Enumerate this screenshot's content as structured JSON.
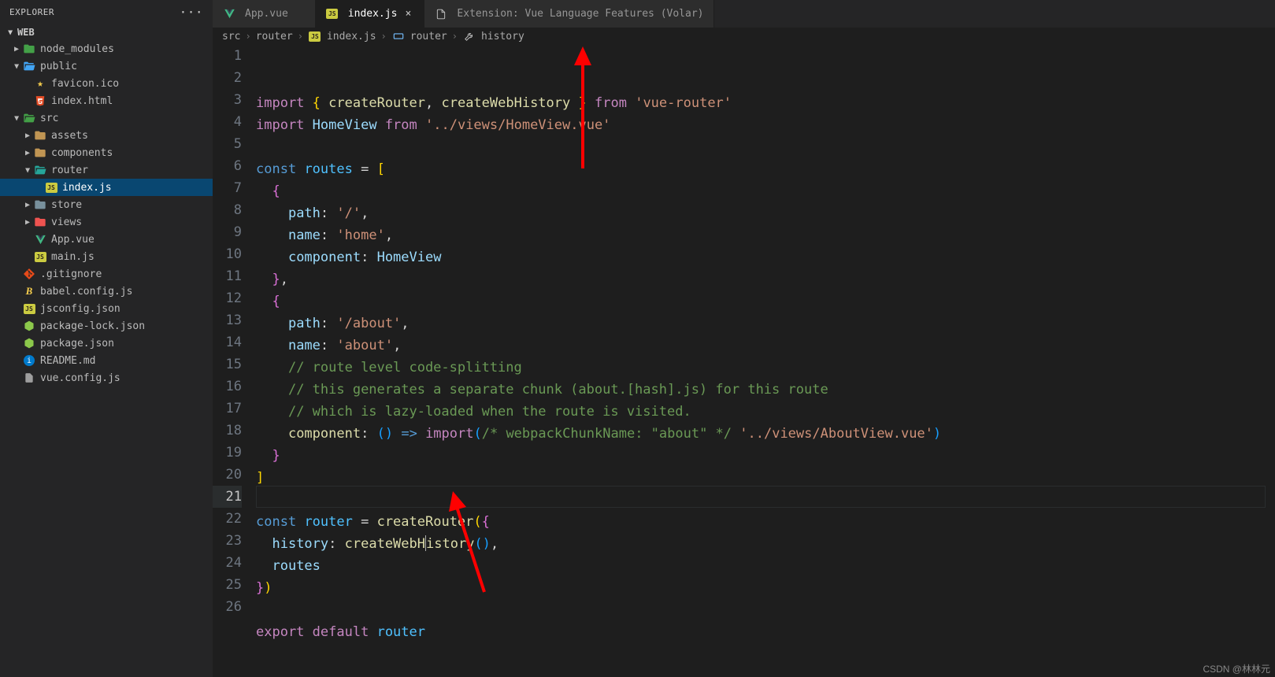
{
  "explorer": {
    "title": "EXPLORER",
    "section": "WEB",
    "tree": [
      {
        "d": 1,
        "kind": "fold",
        "color": "green",
        "open": false,
        "chev": true,
        "name": "node_modules"
      },
      {
        "d": 1,
        "kind": "fold",
        "color": "blue",
        "open": true,
        "chev": true,
        "name": "public"
      },
      {
        "d": 2,
        "kind": "star",
        "name": "favicon.ico"
      },
      {
        "d": 2,
        "kind": "html",
        "name": "index.html"
      },
      {
        "d": 1,
        "kind": "fold",
        "color": "green",
        "open": true,
        "chev": true,
        "name": "src"
      },
      {
        "d": 2,
        "kind": "fold",
        "color": "default",
        "open": false,
        "chev": true,
        "name": "assets"
      },
      {
        "d": 2,
        "kind": "fold",
        "color": "default",
        "open": false,
        "chev": true,
        "name": "components"
      },
      {
        "d": 2,
        "kind": "fold",
        "color": "teal",
        "open": true,
        "chev": true,
        "name": "router"
      },
      {
        "d": 3,
        "kind": "js",
        "name": "index.js",
        "active": true
      },
      {
        "d": 2,
        "kind": "fold",
        "color": "grey",
        "open": false,
        "chev": true,
        "name": "store"
      },
      {
        "d": 2,
        "kind": "fold",
        "color": "red",
        "open": false,
        "chev": true,
        "name": "views"
      },
      {
        "d": 2,
        "kind": "vue",
        "name": "App.vue"
      },
      {
        "d": 2,
        "kind": "js",
        "name": "main.js"
      },
      {
        "d": 1,
        "kind": "git",
        "name": ".gitignore"
      },
      {
        "d": 1,
        "kind": "babel",
        "name": "babel.config.js"
      },
      {
        "d": 1,
        "kind": "js",
        "name": "jsconfig.json"
      },
      {
        "d": 1,
        "kind": "node",
        "name": "package-lock.json"
      },
      {
        "d": 1,
        "kind": "node",
        "name": "package.json"
      },
      {
        "d": 1,
        "kind": "info",
        "name": "README.md"
      },
      {
        "d": 1,
        "kind": "vueconf",
        "name": "vue.config.js"
      }
    ]
  },
  "tabs": [
    {
      "icon": "vue",
      "label": "App.vue",
      "active": false,
      "closable": true
    },
    {
      "icon": "js",
      "label": "index.js",
      "active": true,
      "closable": true
    },
    {
      "icon": "ext",
      "label": "Extension: Vue Language Features (Volar)",
      "active": false,
      "closable": false
    }
  ],
  "breadcrumbs": [
    {
      "label": "src"
    },
    {
      "label": "router"
    },
    {
      "icon": "js",
      "label": "index.js"
    },
    {
      "icon": "var",
      "label": "router"
    },
    {
      "icon": "wrench",
      "label": "history"
    }
  ],
  "code": {
    "current_line": 21,
    "lines": [
      {
        "n": 1,
        "t": [
          [
            "kw",
            "import"
          ],
          [
            "pn",
            " "
          ],
          [
            "br",
            "{"
          ],
          [
            "pn",
            " "
          ],
          [
            "fn",
            "createRouter"
          ],
          [
            "pn",
            ", "
          ],
          [
            "fn",
            "createWebHistory"
          ],
          [
            "pn",
            " "
          ],
          [
            "br",
            "}"
          ],
          [
            "pn",
            " "
          ],
          [
            "kw",
            "from"
          ],
          [
            "pn",
            " "
          ],
          [
            "str",
            "'vue-router'"
          ]
        ]
      },
      {
        "n": 2,
        "t": [
          [
            "kw",
            "import"
          ],
          [
            "pn",
            " "
          ],
          [
            "id",
            "HomeView"
          ],
          [
            "pn",
            " "
          ],
          [
            "kw",
            "from"
          ],
          [
            "pn",
            " "
          ],
          [
            "str",
            "'../views/HomeView.vue'"
          ]
        ]
      },
      {
        "n": 3,
        "t": []
      },
      {
        "n": 4,
        "t": [
          [
            "def",
            "const"
          ],
          [
            "pn",
            " "
          ],
          [
            "var",
            "routes"
          ],
          [
            "pn",
            " = "
          ],
          [
            "br",
            "["
          ]
        ]
      },
      {
        "n": 5,
        "t": [
          [
            "pn",
            "  "
          ],
          [
            "br2",
            "{"
          ]
        ]
      },
      {
        "n": 6,
        "t": [
          [
            "pn",
            "    "
          ],
          [
            "id",
            "path"
          ],
          [
            "pn",
            ":"
          ],
          [
            "pn",
            " "
          ],
          [
            "str",
            "'/'"
          ],
          [
            "pn",
            ","
          ]
        ]
      },
      {
        "n": 7,
        "t": [
          [
            "pn",
            "    "
          ],
          [
            "id",
            "name"
          ],
          [
            "pn",
            ":"
          ],
          [
            "pn",
            " "
          ],
          [
            "str",
            "'home'"
          ],
          [
            "pn",
            ","
          ]
        ]
      },
      {
        "n": 8,
        "t": [
          [
            "pn",
            "    "
          ],
          [
            "id",
            "component"
          ],
          [
            "pn",
            ":"
          ],
          [
            "pn",
            " "
          ],
          [
            "id",
            "HomeView"
          ]
        ]
      },
      {
        "n": 9,
        "t": [
          [
            "pn",
            "  "
          ],
          [
            "br2",
            "}"
          ],
          [
            "pn",
            ","
          ]
        ]
      },
      {
        "n": 10,
        "t": [
          [
            "pn",
            "  "
          ],
          [
            "br2",
            "{"
          ]
        ]
      },
      {
        "n": 11,
        "t": [
          [
            "pn",
            "    "
          ],
          [
            "id",
            "path"
          ],
          [
            "pn",
            ":"
          ],
          [
            "pn",
            " "
          ],
          [
            "str",
            "'/about'"
          ],
          [
            "pn",
            ","
          ]
        ]
      },
      {
        "n": 12,
        "t": [
          [
            "pn",
            "    "
          ],
          [
            "id",
            "name"
          ],
          [
            "pn",
            ":"
          ],
          [
            "pn",
            " "
          ],
          [
            "str",
            "'about'"
          ],
          [
            "pn",
            ","
          ]
        ]
      },
      {
        "n": 13,
        "t": [
          [
            "pn",
            "    "
          ],
          [
            "cm",
            "// route level code-splitting"
          ]
        ]
      },
      {
        "n": 14,
        "t": [
          [
            "pn",
            "    "
          ],
          [
            "cm",
            "// this generates a separate chunk (about.[hash].js) for this route"
          ]
        ]
      },
      {
        "n": 15,
        "t": [
          [
            "pn",
            "    "
          ],
          [
            "cm",
            "// which is lazy-loaded when the route is visited."
          ]
        ]
      },
      {
        "n": 16,
        "t": [
          [
            "pn",
            "    "
          ],
          [
            "fn",
            "component"
          ],
          [
            "pn",
            ":"
          ],
          [
            "pn",
            " "
          ],
          [
            "br3",
            "("
          ],
          [
            "br3",
            ")"
          ],
          [
            "pn",
            " "
          ],
          [
            "def",
            "=>"
          ],
          [
            "pn",
            " "
          ],
          [
            "kw",
            "import"
          ],
          [
            "br3",
            "("
          ],
          [
            "cm",
            "/* webpackChunkName: \"about\" */"
          ],
          [
            "pn",
            " "
          ],
          [
            "str",
            "'../views/AboutView.vue'"
          ],
          [
            "br3",
            ")"
          ]
        ]
      },
      {
        "n": 17,
        "t": [
          [
            "pn",
            "  "
          ],
          [
            "br2",
            "}"
          ]
        ]
      },
      {
        "n": 18,
        "t": [
          [
            "br",
            "]"
          ]
        ]
      },
      {
        "n": 19,
        "t": []
      },
      {
        "n": 20,
        "t": [
          [
            "def",
            "const"
          ],
          [
            "pn",
            " "
          ],
          [
            "var",
            "router"
          ],
          [
            "pn",
            " = "
          ],
          [
            "fn",
            "createRouter"
          ],
          [
            "br",
            "("
          ],
          [
            "br2",
            "{"
          ]
        ]
      },
      {
        "n": 21,
        "hl": true,
        "t": [
          [
            "pn",
            "  "
          ],
          [
            "id",
            "history"
          ],
          [
            "pn",
            ":"
          ],
          [
            "pn",
            " "
          ],
          [
            "fn",
            "createWebH"
          ],
          [
            "cursor",
            ""
          ],
          [
            "fn",
            "istory"
          ],
          [
            "br3",
            "("
          ],
          [
            "br3",
            ")"
          ],
          [
            "pn",
            ","
          ]
        ]
      },
      {
        "n": 22,
        "t": [
          [
            "pn",
            "  "
          ],
          [
            "id",
            "routes"
          ]
        ]
      },
      {
        "n": 23,
        "t": [
          [
            "br2",
            "}"
          ],
          [
            "br",
            ")"
          ]
        ]
      },
      {
        "n": 24,
        "t": []
      },
      {
        "n": 25,
        "t": [
          [
            "kw",
            "export"
          ],
          [
            "pn",
            " "
          ],
          [
            "kw",
            "default"
          ],
          [
            "pn",
            " "
          ],
          [
            "var",
            "router"
          ]
        ]
      },
      {
        "n": 26,
        "t": []
      }
    ]
  },
  "watermark": "CSDN @林林元"
}
